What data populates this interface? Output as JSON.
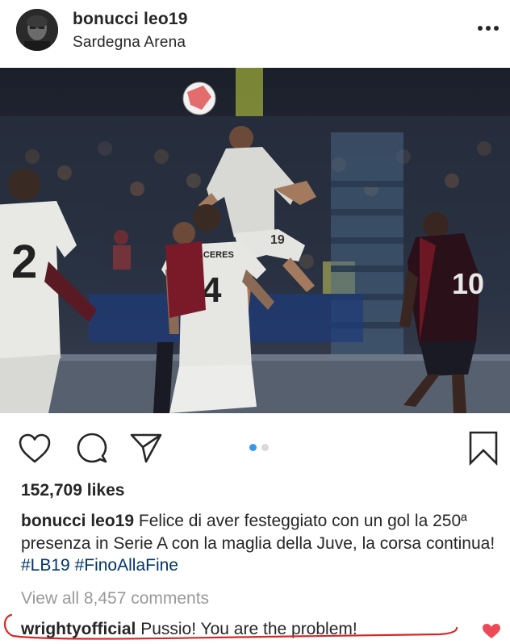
{
  "post": {
    "username": "bonucci leo19",
    "location": "Sardegna Arena"
  },
  "photo": {
    "jersey_back_name": "CACERES",
    "jersey_back_number": "4",
    "jersey_left_number": "2",
    "jersey_right_number": "10",
    "jersey_scorer_number": "19"
  },
  "actions": {
    "icons": [
      "heart-icon",
      "comment-icon",
      "share-icon",
      "bookmark-icon"
    ],
    "carousel_active_color": "#3897f0",
    "carousel_inactive_color": "#d9d9d9"
  },
  "likes": "152,709 likes",
  "caption": {
    "username": "bonucci leo19",
    "text": "Felice di aver festeggiato con un gol la 250ª presenza in Serie A con la maglia della Juve, la corsa continua!",
    "hashtags": [
      "#LB19",
      "#FinoAllaFine"
    ]
  },
  "comments": {
    "view_all": "View all 8,457 comments",
    "items": [
      {
        "username": "wrightyofficial",
        "text": "Pussio! You are the problem!"
      }
    ]
  },
  "colors": {
    "like_red": "#ed4956",
    "hashtag_blue": "#003569",
    "annotation_red": "#d62828"
  }
}
